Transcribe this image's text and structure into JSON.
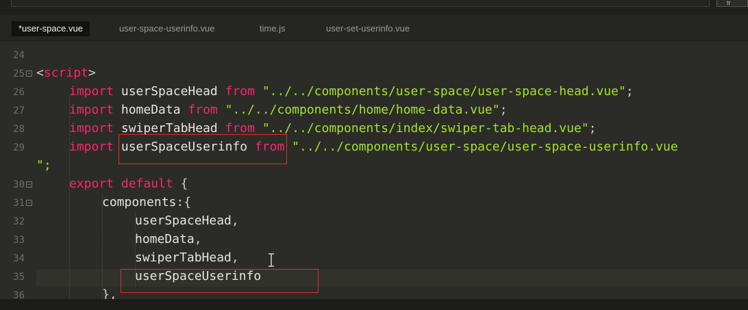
{
  "window": {
    "top_button_label": "tr"
  },
  "tabs": [
    {
      "label": "*user-space.vue",
      "active": true
    },
    {
      "label": "user-space-userinfo.vue",
      "active": false
    },
    {
      "label": "time.js",
      "active": false
    },
    {
      "label": "user-set-userinfo.vue",
      "active": false
    }
  ],
  "editor": {
    "lines": [
      {
        "number": "24",
        "foldable": false
      },
      {
        "number": "25",
        "foldable": true,
        "text": {
          "open": "<",
          "tag": "script",
          "close": ">"
        }
      },
      {
        "number": "26",
        "foldable": false,
        "text": {
          "kw_import": "import",
          "name": "userSpaceHead",
          "kw_from": "from",
          "path": "\"../../components/user-space/user-space-head.vue\"",
          "end": ";"
        }
      },
      {
        "number": "27",
        "foldable": false,
        "text": {
          "kw_import": "import",
          "name": "homeData",
          "kw_from": "from",
          "path": "\"../../components/home/home-data.vue\"",
          "end": ";"
        }
      },
      {
        "number": "28",
        "foldable": false,
        "text": {
          "kw_import": "import",
          "name": "swiperTabHead",
          "kw_from": "from",
          "path": "\"../../components/index/swiper-tab-head.vue\"",
          "end": ";"
        }
      },
      {
        "number": "29",
        "foldable": false,
        "text": {
          "kw_import": "import",
          "name": "userSpaceUserinfo",
          "kw_from": "from",
          "path": "\"../../components/user-space/user-space-userinfo.vue",
          "wrap": "\";"
        }
      },
      {
        "number": "30",
        "foldable": true,
        "text": {
          "kw_export": "export",
          "kw_default": "default",
          "brace": "{"
        }
      },
      {
        "number": "31",
        "foldable": true,
        "text": {
          "prop": "components",
          "punct": ":{"
        }
      },
      {
        "number": "32",
        "foldable": false,
        "text": {
          "value": "userSpaceHead",
          "comma": ","
        }
      },
      {
        "number": "33",
        "foldable": false,
        "text": {
          "value": "homeData",
          "comma": ","
        }
      },
      {
        "number": "34",
        "foldable": false,
        "text": {
          "value": "swiperTabHead",
          "comma": ","
        }
      },
      {
        "number": "35",
        "foldable": false,
        "text": {
          "value": "userSpaceUserinfo"
        }
      },
      {
        "number": "36",
        "foldable": false,
        "text": {
          "value": "},"
        }
      }
    ]
  },
  "colors": {
    "keyword": "#f92672",
    "string": "#a6e22e",
    "annotation_box": "#e0312b",
    "background": "#272822"
  }
}
